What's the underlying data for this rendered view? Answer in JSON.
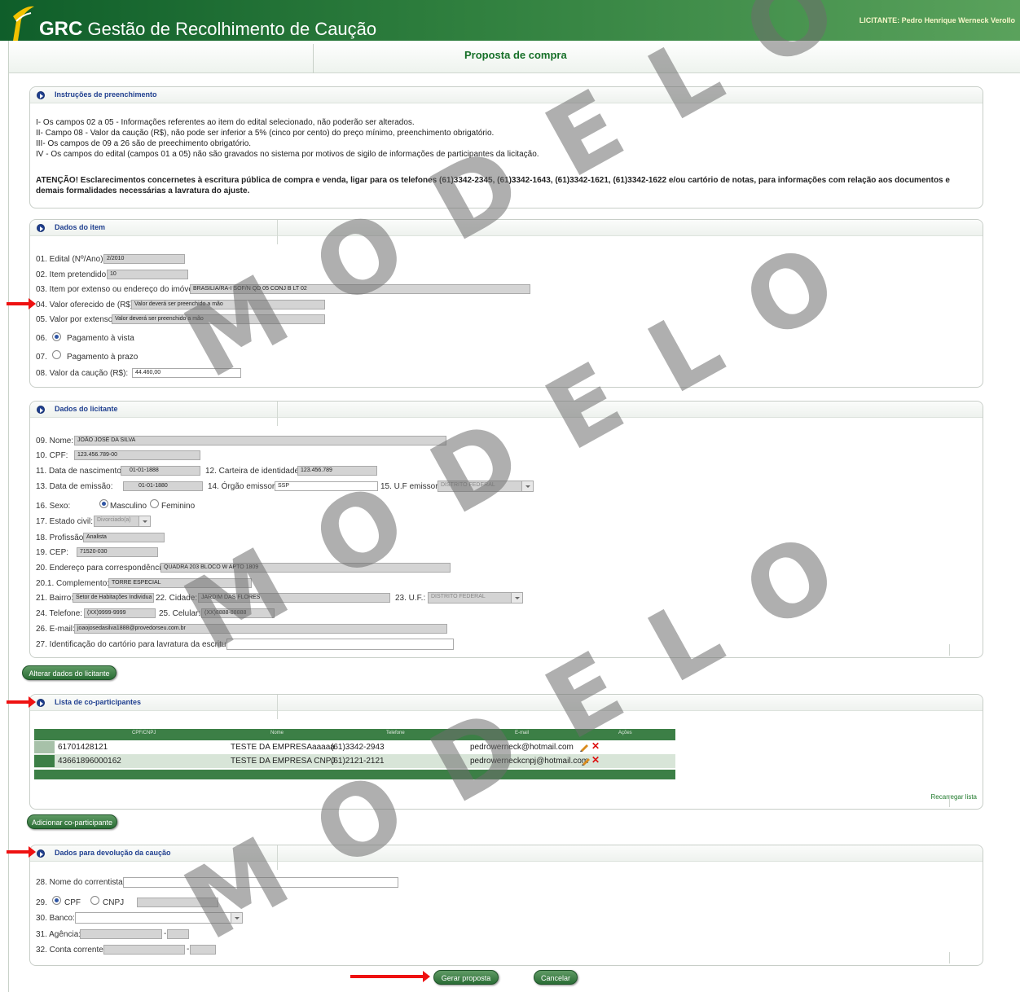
{
  "header": {
    "brand": "GRC",
    "app_name": "Gestão de Recolhimento de Caução",
    "user_label": "LICITANTE: Pedro Henrique Werneck Verollo"
  },
  "page_title": "Proposta de compra",
  "instructions": {
    "title": "Instruções de preenchimento",
    "lines": [
      "I- Os campos 02 a 05 - Informações referentes ao item do edital selecionado, não poderão ser alterados.",
      "II- Campo 08 - Valor da caução (R$), não pode ser inferior a 5% (cinco por cento) do preço mínimo, preenchimento obrigatório.",
      "III- Os campos de 09 a 26 são de preechimento obrigatório.",
      "IV - Os campos do edital (campos 01 a 05) não são gravados no sistema por motivos de sigilo de informações de participantes da licitação."
    ],
    "attention": "ATENÇÃO! Esclarecimentos concernetes à escritura pública de compra e venda, ligar para os telefones (61)3342-2345, (61)3342-1643, (61)3342-1621, (61)3342-1622 e/ou cartório de notas, para informações com relação aos documentos e demais formalidades necessárias a lavratura do ajuste."
  },
  "item": {
    "title": "Dados do item",
    "edital_label": "01. Edital (Nº/Ano):",
    "edital_value": "2/2010",
    "item_label": "02. Item pretendido:",
    "item_value": "10",
    "extenso_label": "03. Item por extenso ou endereço do imóvel:",
    "extenso_value": "BRASILIA/RA-I SOF/N QD 05 CONJ B LT 02",
    "valor_label": "04. Valor oferecido de (R$):",
    "valor_value": "Valor deverá ser preenchido a mão",
    "valor_extenso_label": "05. Valor por extenso:",
    "valor_extenso_value": "Valor deverá ser preenchido a mão",
    "vista_num": "06.",
    "vista_label": "Pagamento à vista",
    "prazo_num": "07.",
    "prazo_label": "Pagamento à prazo",
    "caucao_label": "08. Valor da caução (R$):",
    "caucao_value": "44.460,00"
  },
  "licitante": {
    "title": "Dados do licitante",
    "nome_label": "09. Nome:",
    "nome_value": "JOÃO JOSÉ DA SILVA",
    "cpf_label": "10. CPF:",
    "cpf_value": "123.456.789-00",
    "nasc_label": "11. Data de nascimento:",
    "nasc_value": "01-01-1888",
    "rg_label": "12. Carteira de identidade:",
    "rg_value": "123.456.789",
    "emissao_label": "13. Data de emissão:",
    "emissao_value": "01-01-1880",
    "orgao_label": "14. Órgão emissor:",
    "orgao_value": "SSP",
    "uf_emissor_label": "15. U.F emissor",
    "uf_emissor_value": "DISTRITO FEDERAL",
    "sexo_label": "16. Sexo:",
    "masc_label": "Masculino",
    "fem_label": "Feminino",
    "civil_label": "17. Estado civil:",
    "civil_value": "Divorciado(a)",
    "profissao_label": "18. Profissão",
    "profissao_value": "Analista",
    "cep_label": "19. CEP:",
    "cep_value": "71520-030",
    "endereco_label": "20. Endereço para correspondência:",
    "endereco_value": "QUADRA 203 BLOCO W APTO 1809",
    "complemento_label": "20.1. Complemento:",
    "complemento_value": "TORRE ESPECIAL",
    "bairro_label": "21. Bairro:",
    "bairro_value": "Setor de Habitações Individua",
    "cidade_label": "22. Cidade:",
    "cidade_value": "JARDIM DAS FLORES",
    "uf_label": "23. U.F.:",
    "uf_value": "DISTRITO FEDERAL",
    "telefone_label": "24. Telefone:",
    "telefone_value": "(XX)9999-9999",
    "celular_label": "25. Celular:",
    "celular_value": "(XX)8888-88888",
    "email_label": "26. E-mail:",
    "email_value": "joaojosedasilva1888@provedorseu.com.br",
    "cartorio_label": "27. Identificação do cartório para lavratura da escritura:",
    "cartorio_value": ""
  },
  "alterar_button": "Alterar dados do licitante",
  "coparticipantes": {
    "title": "Lista de co-participantes",
    "columns": [
      "CPF/CNPJ",
      "Nome",
      "Telefone",
      "E-mail",
      "Ações"
    ],
    "rows": [
      {
        "doc": "61701428121",
        "nome": "TESTE DA EMPRESAaaaaa",
        "telefone": "(61)3342-2943",
        "email": "pedrowerneck@hotmail.com"
      },
      {
        "doc": "43661896000162",
        "nome": "TESTE DA EMPRESA CNPJ",
        "telefone": "(61)2121-2121",
        "email": "pedrowerneckcnpj@hotmail.com"
      }
    ],
    "reload_link": "Recarregar lista"
  },
  "adicionar_button": "Adicionar co-participante",
  "devolucao": {
    "title": "Dados para devolução da caução",
    "correntista_label": "28. Nome do correntista:",
    "tipo_num": "29.",
    "cpf_label": "CPF",
    "cnpj_label": "CNPJ",
    "banco_label": "30. Banco:",
    "agencia_label": "31. Agência:",
    "conta_label": "32. Conta corrente:",
    "dash": "-"
  },
  "gerar_button": "Gerar proposta",
  "cancelar_button": "Cancelar",
  "watermark": "MODELO",
  "colors": {
    "accent": "#2a6d35",
    "title_blue": "#1f3f8f",
    "arrow_red": "#e11111"
  }
}
